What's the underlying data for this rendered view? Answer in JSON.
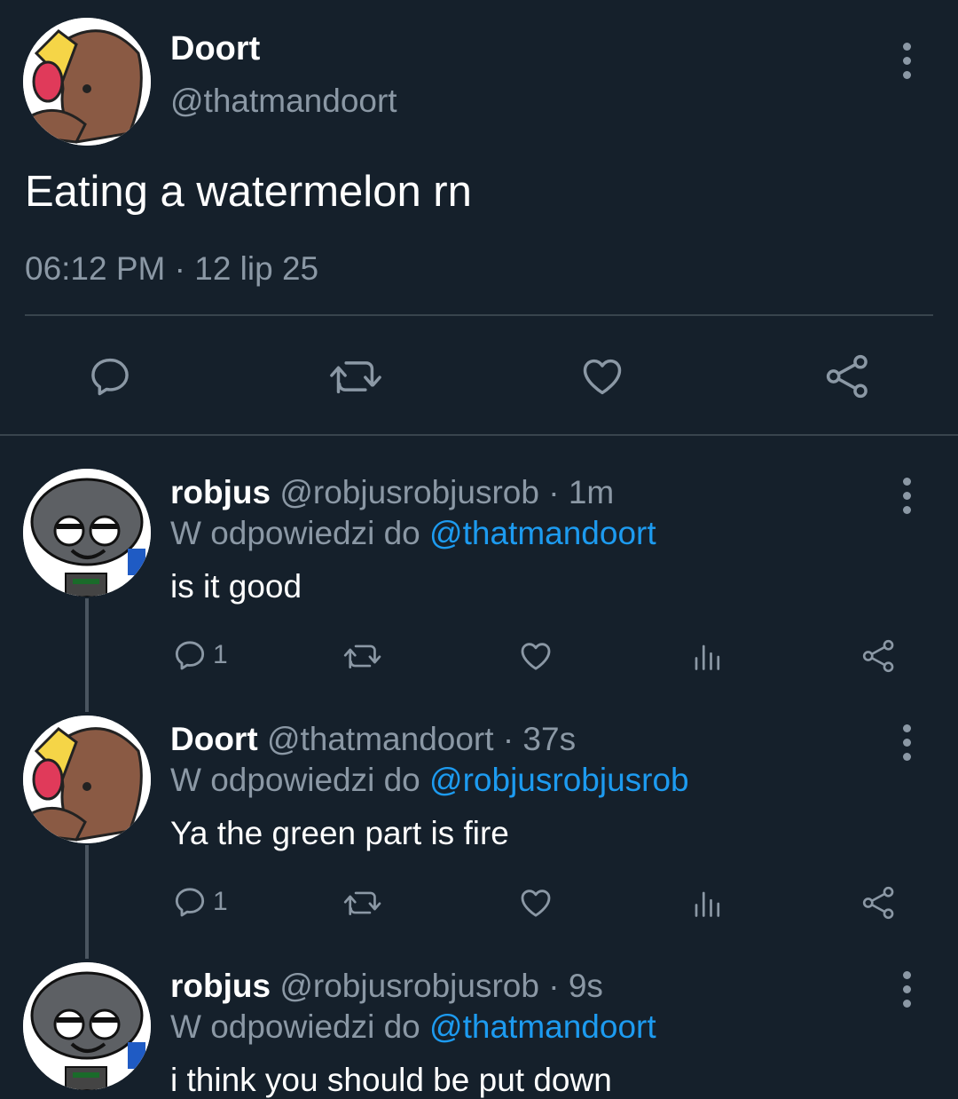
{
  "main_tweet": {
    "display_name": "Doort",
    "handle": "@thatmandoort",
    "text": "Eating a watermelon rn",
    "timestamp": "06:12 PM · 12 lip 25"
  },
  "replies": [
    {
      "display_name": "robjus",
      "handle": "@robjusrobjusrob",
      "separator": "·",
      "time": "1m",
      "reply_prefix": "W odpowiedzi do",
      "reply_to": "@thatmandoort",
      "text": "is it good",
      "reply_count": "1"
    },
    {
      "display_name": "Doort",
      "handle": "@thatmandoort",
      "separator": "·",
      "time": "37s",
      "reply_prefix": "W odpowiedzi do",
      "reply_to": "@robjusrobjusrob",
      "text": "Ya the green part is fire",
      "reply_count": "1"
    },
    {
      "display_name": "robjus",
      "handle": "@robjusrobjusrob",
      "separator": "·",
      "time": "9s",
      "reply_prefix": "W odpowiedzi do",
      "reply_to": "@thatmandoort",
      "text": "i think you should be put down"
    }
  ],
  "colors": {
    "background": "#15202b",
    "muted": "#8b98a5",
    "link": "#1d9bf0",
    "divider": "#38444d"
  },
  "icons": {
    "reply": "reply-icon",
    "retweet": "retweet-icon",
    "like": "heart-icon",
    "views": "views-icon",
    "share": "share-icon",
    "more": "more-options-icon"
  }
}
